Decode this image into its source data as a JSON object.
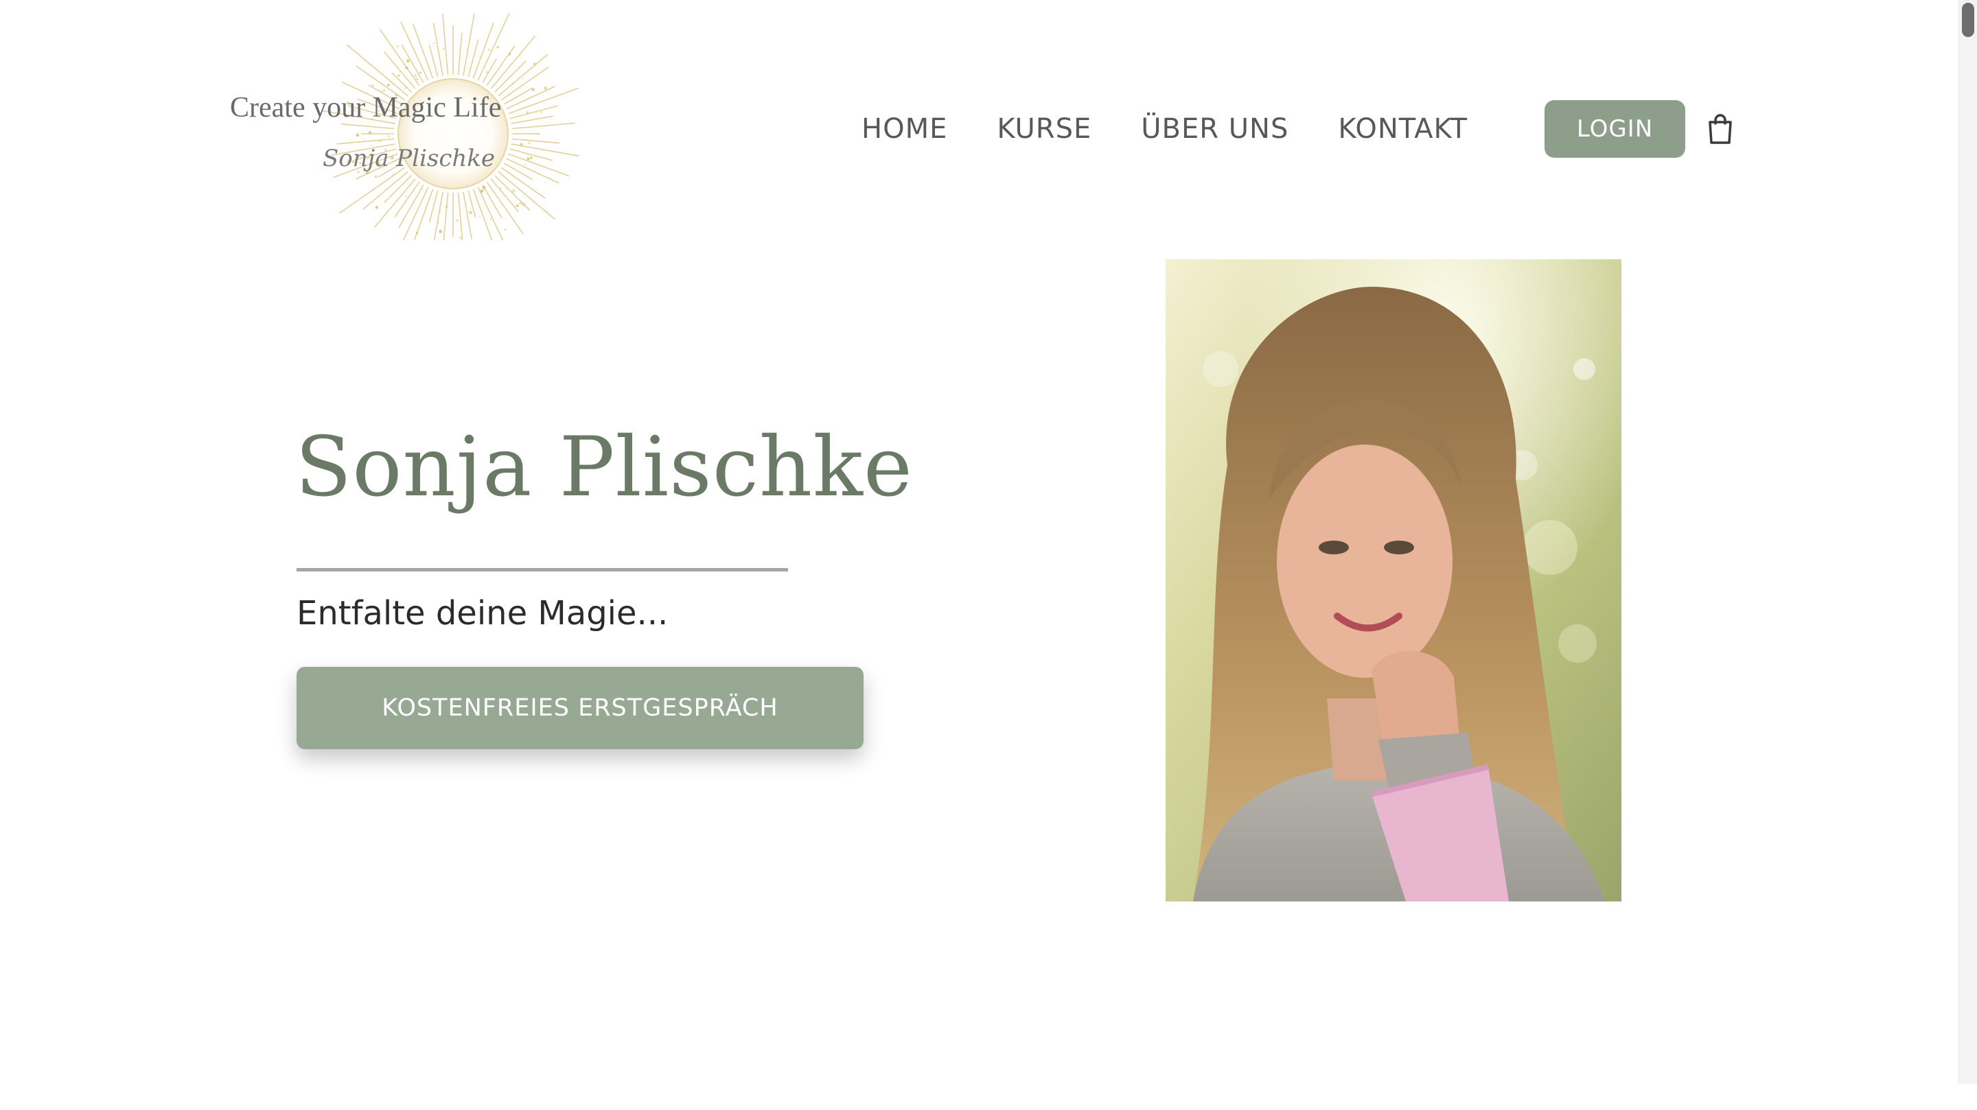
{
  "logo": {
    "line1": "Create your Magic Life",
    "line2": "Sonja Plischke",
    "icon": "sun-burst-logo"
  },
  "nav": {
    "items": [
      {
        "label": "HOME"
      },
      {
        "label": "KURSE"
      },
      {
        "label": "ÜBER UNS"
      },
      {
        "label": "KONTAKT"
      }
    ],
    "login_label": "LOGIN",
    "cart_icon": "shopping-bag-icon"
  },
  "hero": {
    "name": "Sonja Plischke",
    "tagline": "Entfalte deine Magie...",
    "cta_label": "KOSTENFREIES ERSTGESPRÄCH"
  },
  "portrait": {
    "subject": "portrait-photo"
  },
  "colors": {
    "accent_green": "#8d9f8a",
    "heading_green": "#6b7a66",
    "nav_text": "#555a55",
    "logo_gold": "#d9c37a"
  }
}
